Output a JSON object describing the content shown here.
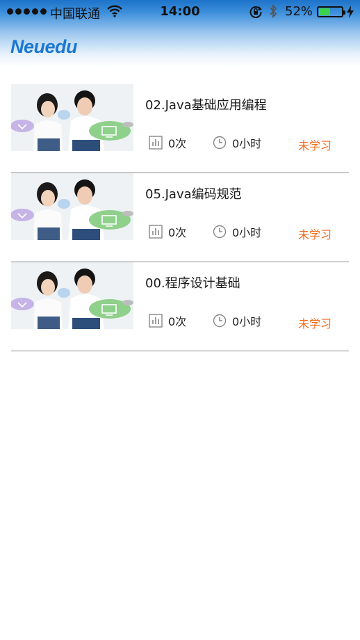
{
  "status_bar": {
    "carrier": "中国联通",
    "time": "14:00",
    "battery_percent": "52%",
    "battery_level": 0.52
  },
  "header": {
    "logo_text": "Neuedu"
  },
  "courses": [
    {
      "title": "02.Java基础应用编程",
      "count": "0次",
      "hours": "0小时",
      "status": "未学习"
    },
    {
      "title": "05.Java编码规范",
      "count": "0次",
      "hours": "0小时",
      "status": "未学习"
    },
    {
      "title": "00.程序设计基础",
      "count": "0次",
      "hours": "0小时",
      "status": "未学习"
    }
  ],
  "colors": {
    "brand": "#1b78d0",
    "status_orange": "#f26a1b",
    "battery_green": "#3bd34a"
  },
  "icons": {
    "count": "bar-chart-icon",
    "hours": "clock-icon"
  }
}
